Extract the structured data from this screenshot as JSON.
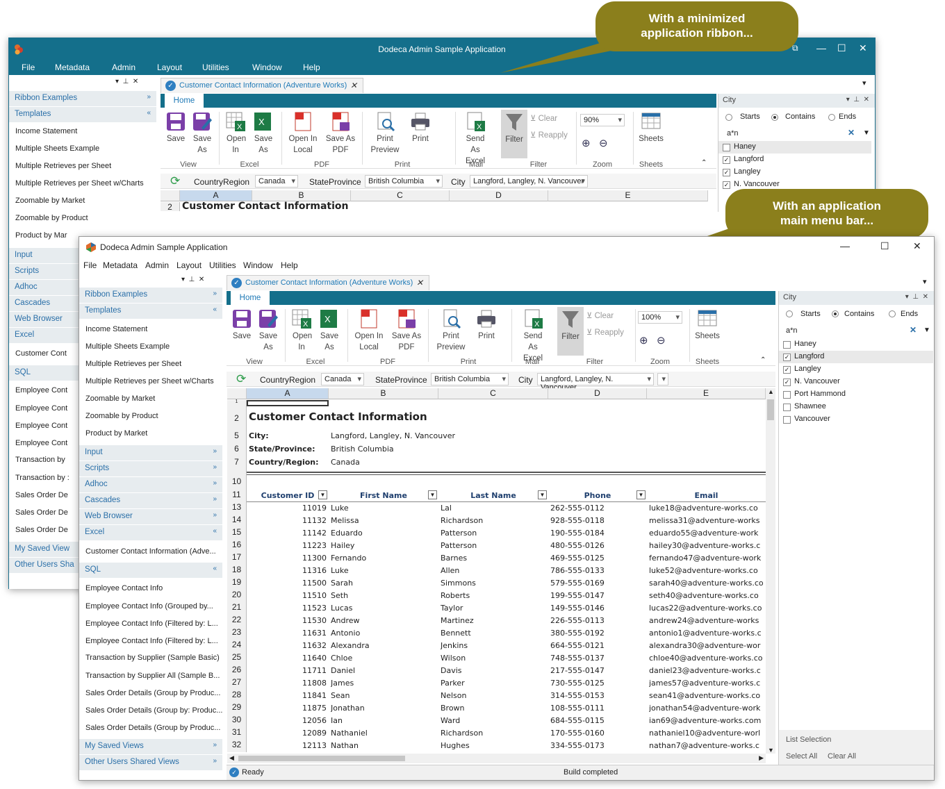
{
  "callouts": {
    "top": "With a minimized application ribbon...",
    "bottom": "With an application main menu bar..."
  },
  "app": {
    "title": "Dodeca Admin Sample Application"
  },
  "menu": [
    "File",
    "Metadata",
    "Admin",
    "Layout",
    "Utilities",
    "Window",
    "Help"
  ],
  "nav": {
    "groups": {
      "ribbon": "Ribbon Examples",
      "templates": "Templates",
      "input": "Input",
      "scripts": "Scripts",
      "adhoc": "Adhoc",
      "cascades": "Cascades",
      "web": "Web Browser",
      "excel": "Excel",
      "sql": "SQL",
      "saved": "My Saved Views",
      "shared": "Other Users Shared Views"
    },
    "templates": [
      "Income Statement",
      "Multiple Sheets Example",
      "Multiple Retrieves per Sheet",
      "Multiple Retrieves per Sheet w/Charts",
      "Zoomable by Market",
      "Zoomable by Product",
      "Product by Market"
    ],
    "excel_item": "Customer Contact Information (Adve...",
    "sql": [
      "Employee Contact Info",
      "Employee Contact Info (Grouped by...",
      "Employee Contact Info (Filtered by: L...",
      "Employee Contact Info (Filtered by: L...",
      "Transaction by Supplier (Sample Basic)",
      "Transaction by Supplier All (Sample B...",
      "Sales Order Details (Group by Produc...",
      "Sales Order Details (Group by: Produc...",
      "Sales Order Details (Group by Produc..."
    ],
    "w1_excel_item": "Customer Cont",
    "w1_sql": [
      "Employee Cont",
      "Employee Cont",
      "Employee Cont",
      "Employee Cont",
      "Transaction by",
      "Transaction by :",
      "Sales Order De",
      "Sales Order De",
      "Sales Order De"
    ],
    "w1_product": "Product by Mar",
    "w1_saved": "My Saved View",
    "w1_shared": "Other Users Sha"
  },
  "doc": {
    "tab": "Customer Contact Information (Adventure Works)",
    "ribbon_tab": "Home"
  },
  "ribbon": {
    "save": "Save",
    "save_as": "Save As",
    "open_in": "Open In",
    "open_in_local": "Open In Local",
    "save_as_pdf": "Save As PDF",
    "print_preview": "Print Preview",
    "print": "Print",
    "send_as_excel": "Send As Excel",
    "filter": "Filter",
    "clear": "Clear",
    "reapply": "Reapply",
    "sheets": "Sheets",
    "groups": {
      "view": "View",
      "excel": "Excel",
      "pdf": "PDF",
      "print": "Print",
      "mail": "Mail",
      "filter": "Filter",
      "zoom": "Zoom",
      "sheets": "Sheets"
    },
    "zoom_w1": "90%",
    "zoom_w2": "100%"
  },
  "params": {
    "country_label": "CountryRegion",
    "country": "Canada",
    "state_label": "StateProvince",
    "state": "British Columbia",
    "city_label": "City",
    "city": "Langford, Langley, N. Vancouver"
  },
  "sheet": {
    "cols": [
      "A",
      "B",
      "C",
      "D",
      "E"
    ],
    "title": "Customer Contact Information",
    "city_label": "City:",
    "city": "Langford, Langley, N. Vancouver",
    "state_label": "State/Province:",
    "state": "British Columbia",
    "country_label": "Country/Region:",
    "country": "Canada",
    "headers": [
      "Customer ID",
      "First Name",
      "Last Name",
      "Phone",
      "Email"
    ],
    "row_nums": [
      "1",
      "2",
      "5",
      "6",
      "7",
      "10",
      "11"
    ],
    "rows": [
      [
        "13",
        "11019",
        "Luke",
        "Lal",
        "262-555-0112",
        "luke18@adventure-works.co"
      ],
      [
        "14",
        "11132",
        "Melissa",
        "Richardson",
        "928-555-0118",
        "melissa31@adventure-works"
      ],
      [
        "15",
        "11142",
        "Eduardo",
        "Patterson",
        "190-555-0184",
        "eduardo55@adventure-work"
      ],
      [
        "16",
        "11223",
        "Hailey",
        "Patterson",
        "480-555-0126",
        "hailey30@adventure-works.c"
      ],
      [
        "17",
        "11300",
        "Fernando",
        "Barnes",
        "469-555-0125",
        "fernando47@adventure-work"
      ],
      [
        "18",
        "11316",
        "Luke",
        "Allen",
        "786-555-0133",
        "luke52@adventure-works.co"
      ],
      [
        "19",
        "11500",
        "Sarah",
        "Simmons",
        "579-555-0169",
        "sarah40@adventure-works.co"
      ],
      [
        "20",
        "11510",
        "Seth",
        "Roberts",
        "199-555-0147",
        "seth40@adventure-works.co"
      ],
      [
        "21",
        "11523",
        "Lucas",
        "Taylor",
        "149-555-0146",
        "lucas22@adventure-works.co"
      ],
      [
        "22",
        "11530",
        "Andrew",
        "Martinez",
        "226-555-0113",
        "andrew24@adventure-works"
      ],
      [
        "23",
        "11631",
        "Antonio",
        "Bennett",
        "380-555-0192",
        "antonio1@adventure-works.c"
      ],
      [
        "24",
        "11632",
        "Alexandra",
        "Jenkins",
        "664-555-0121",
        "alexandra30@adventure-wor"
      ],
      [
        "25",
        "11640",
        "Chloe",
        "Wilson",
        "748-555-0137",
        "chloe40@adventure-works.co"
      ],
      [
        "26",
        "11711",
        "Daniel",
        "Davis",
        "217-555-0147",
        "daniel23@adventure-works.c"
      ],
      [
        "27",
        "11808",
        "James",
        "Parker",
        "730-555-0125",
        "james57@adventure-works.c"
      ],
      [
        "28",
        "11841",
        "Sean",
        "Nelson",
        "314-555-0153",
        "sean41@adventure-works.co"
      ],
      [
        "29",
        "11875",
        "Jonathan",
        "Brown",
        "108-555-0111",
        "jonathan54@adventure-work"
      ],
      [
        "30",
        "12056",
        "Ian",
        "Ward",
        "684-555-0115",
        "ian69@adventure-works.com"
      ],
      [
        "31",
        "12089",
        "Nathaniel",
        "Richardson",
        "170-555-0160",
        "nathaniel10@adventure-worl"
      ],
      [
        "32",
        "12113",
        "Nathan",
        "Hughes",
        "334-555-0173",
        "nathan7@adventure-works.c"
      ]
    ]
  },
  "filter": {
    "caption": "City",
    "starts": "Starts",
    "contains": "Contains",
    "ends": "Ends",
    "search": "a*n",
    "items": [
      {
        "label": "Haney",
        "checked": false
      },
      {
        "label": "Langford",
        "checked": true
      },
      {
        "label": "Langley",
        "checked": true
      },
      {
        "label": "N. Vancouver",
        "checked": true
      },
      {
        "label": "Port Hammond",
        "checked": false
      },
      {
        "label": "Shawnee",
        "checked": false
      },
      {
        "label": "Vancouver",
        "checked": false
      }
    ],
    "list_selection": "List Selection",
    "select_all": "Select All",
    "clear_all": "Clear All"
  },
  "status": {
    "left": "Ready",
    "center": "Build completed"
  },
  "colors": {
    "accent": "#146f8b",
    "callout": "#8b7f1c",
    "link": "#2a6fa8"
  }
}
